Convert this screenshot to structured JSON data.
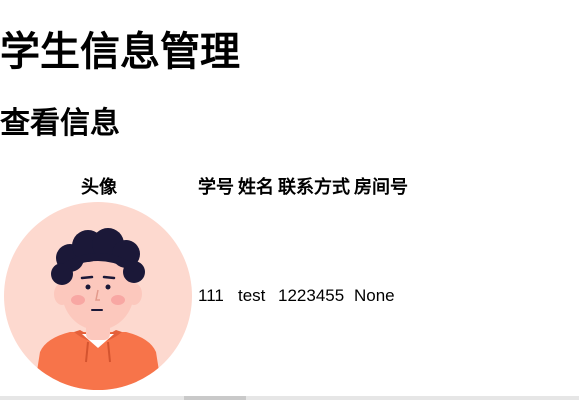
{
  "page": {
    "title": "学生信息管理",
    "section_title": "查看信息"
  },
  "table": {
    "headers": {
      "avatar": "头像",
      "student_id": "学号",
      "name": "姓名",
      "contact": "联系方式",
      "room": "房间号"
    },
    "rows": [
      {
        "avatar_icon": "student-avatar-icon",
        "student_id": "111",
        "name": "test",
        "contact": "1223455",
        "room": "None"
      }
    ]
  },
  "colors": {
    "avatar_bg": "#fdd9cf",
    "hair": "#1b1838",
    "skin": "#fcc8bd",
    "hoodie": "#f7744a",
    "blush": "#f8a7a3"
  }
}
